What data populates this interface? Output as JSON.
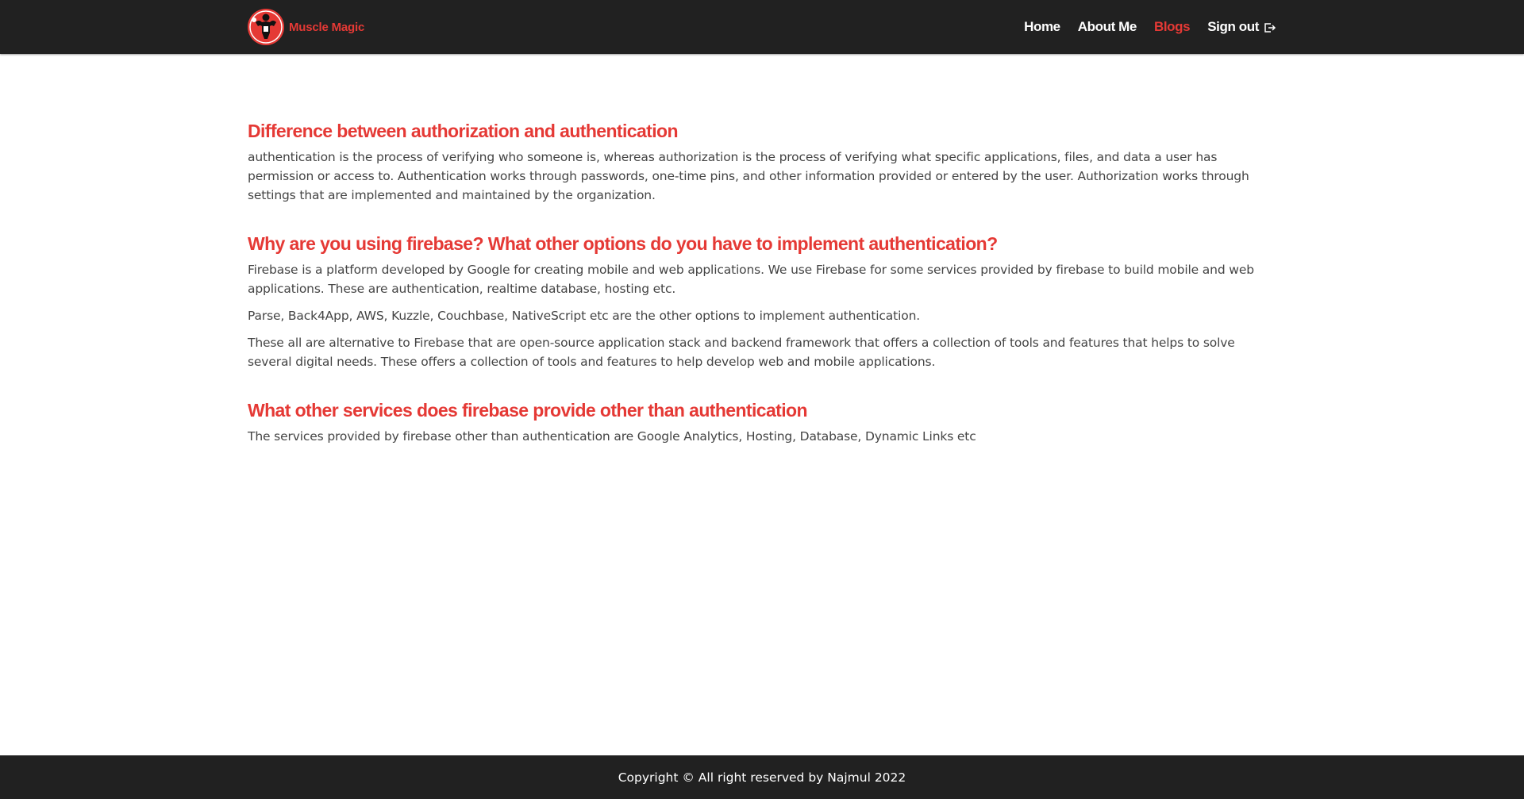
{
  "header": {
    "brand_name": "Muscle Magic",
    "logo_icon": "bodybuilder-logo-icon",
    "nav": [
      {
        "label": "Home",
        "active": false
      },
      {
        "label": "About Me",
        "active": false
      },
      {
        "label": "Blogs",
        "active": true
      },
      {
        "label": "Sign out",
        "active": false,
        "icon": "sign-out-icon"
      }
    ]
  },
  "sections": [
    {
      "title": "Difference between authorization and authentication",
      "paragraphs": [
        "authentication is the process of verifying who someone is, whereas authorization is the process of verifying what specific applications, files, and data a user has permission or access to. Authentication works through passwords, one-time pins, and other information provided or entered by the user. Authorization works through settings that are implemented and maintained by the organization."
      ]
    },
    {
      "title": "Why are you using firebase? What other options do you have to implement authentication?",
      "paragraphs": [
        "Firebase is a platform developed by Google for creating mobile and web applications. We use Firebase for some services provided by firebase to build mobile and web applications. These are authentication, realtime database, hosting etc.",
        "Parse, Back4App, AWS, Kuzzle, Couchbase, NativeScript etc are the other options to implement authentication.",
        "These all are alternative to Firebase that are open-source application stack and backend framework that offers a collection of tools and features that helps to solve several digital needs. These offers a collection of tools and features to help develop web and mobile applications."
      ]
    },
    {
      "title": "What other services does firebase provide other than authentication",
      "paragraphs": [
        "The services provided by firebase other than authentication are Google Analytics, Hosting, Database, Dynamic Links etc"
      ]
    }
  ],
  "footer": {
    "copyright": "Copyright © All right reserved by Najmul 2022"
  },
  "colors": {
    "accent": "#e53935",
    "navbar_bg": "#212121",
    "body_text": "#444444"
  }
}
